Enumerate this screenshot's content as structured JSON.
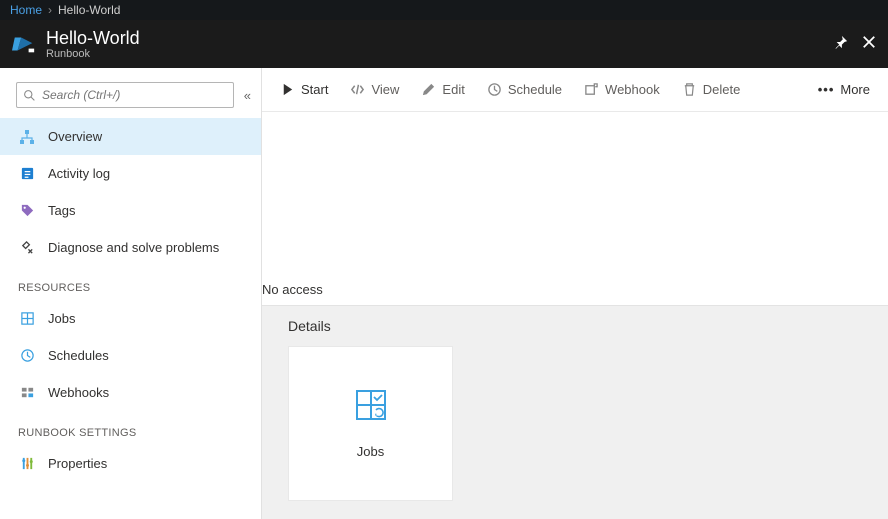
{
  "breadcrumb": {
    "home": "Home",
    "current": "Hello-World"
  },
  "header": {
    "title": "Hello-World",
    "subtitle": "Runbook"
  },
  "search": {
    "placeholder": "Search (Ctrl+/)"
  },
  "nav": {
    "items": [
      {
        "label": "Overview"
      },
      {
        "label": "Activity log"
      },
      {
        "label": "Tags"
      },
      {
        "label": "Diagnose and solve problems"
      }
    ],
    "section_resources": "RESOURCES",
    "resources": [
      {
        "label": "Jobs"
      },
      {
        "label": "Schedules"
      },
      {
        "label": "Webhooks"
      }
    ],
    "section_settings": "RUNBOOK SETTINGS",
    "settings": [
      {
        "label": "Properties"
      }
    ]
  },
  "toolbar": {
    "start": "Start",
    "view": "View",
    "edit": "Edit",
    "schedule": "Schedule",
    "webhook": "Webhook",
    "delete": "Delete",
    "more": "More"
  },
  "body": {
    "no_access": "No access",
    "details_title": "Details",
    "tile_jobs": "Jobs"
  },
  "colors": {
    "accent": "#0078d4",
    "tile_icon": "#3aa0e0"
  }
}
